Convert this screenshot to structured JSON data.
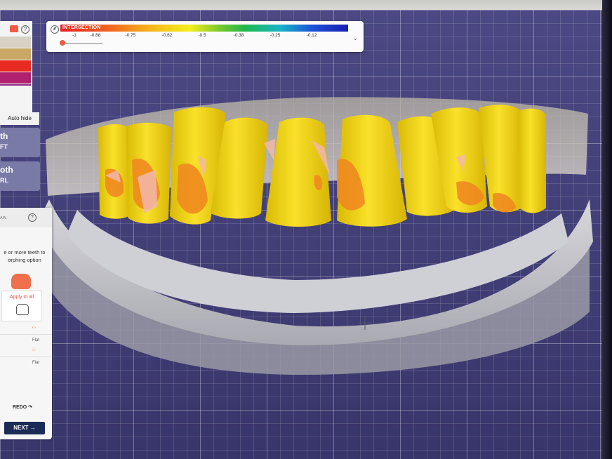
{
  "legend": {
    "title": "INTERSECTION",
    "ticks": [
      "-1",
      "-0.88",
      "-0.75",
      "-0.62",
      "-0.5",
      "-0.38",
      "-0.25",
      "-0.12"
    ]
  },
  "left_panel": {
    "swatches": [
      "#d8d2c4",
      "#c9a764",
      "#e82b22",
      "#b0206e",
      "#8e2b86"
    ],
    "auto_hide_label": "Auto hide",
    "tooth_left": {
      "line1": "th",
      "line2": "FT"
    },
    "tooth_right": {
      "line1": "oth",
      "line2": "RL"
    }
  },
  "tool_panel": {
    "header_label": "AIN",
    "help_glyph": "?",
    "instruction": "e or more teeth to\norphing option",
    "apply_label": "Apply to all",
    "rows": [
      {
        "arrows": "‹    ›",
        "label": "Flat"
      },
      {
        "arrows": "‹    ›",
        "label": "Flat"
      }
    ],
    "redo_label": "REDO ↷",
    "next_label": "NEXT →"
  },
  "colors": {
    "tooth_yellow": "#f2d50e",
    "intersection_orange": "#f08a1f",
    "model_gray": "#c7c7cc",
    "background_purple": "#45427c"
  }
}
